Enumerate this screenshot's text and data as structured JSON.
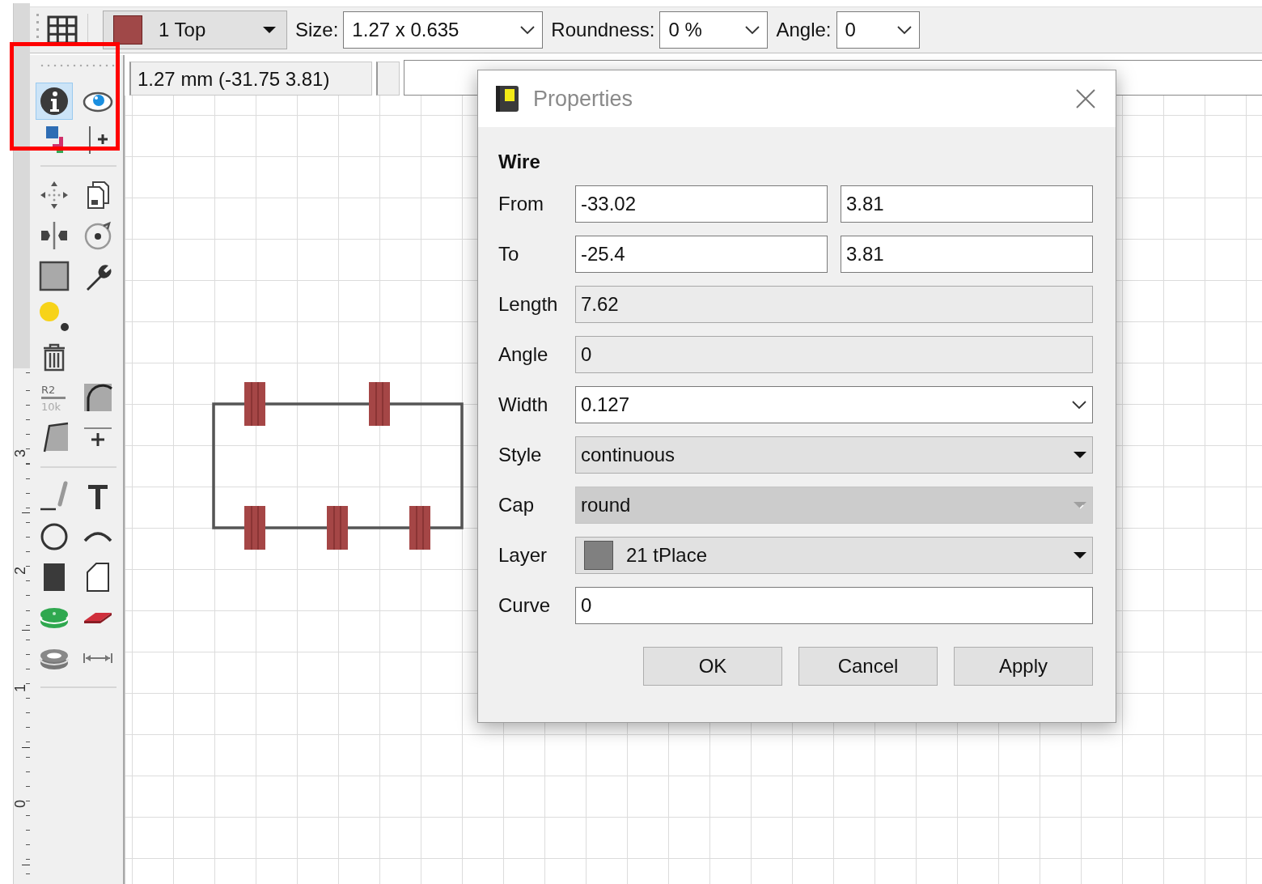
{
  "toolbar": {
    "layer": {
      "label": "1 Top",
      "color": "#a04848"
    },
    "fields": [
      {
        "label": "Size:",
        "value": "1.27 x 0.635"
      },
      {
        "label": "Roundness:",
        "value": "0 %"
      },
      {
        "label": "Angle:",
        "value": "0"
      }
    ]
  },
  "coordinates": {
    "readout": "1.27 mm (-31.75 3.81)"
  },
  "tool_groups": [
    [
      [
        {
          "selected": true
        },
        {
          "selected": false
        }
      ],
      [
        {
          "selected": false
        },
        {
          "selected": false
        }
      ]
    ],
    [
      [
        {
          "selected": false
        },
        {
          "selected": false
        }
      ],
      [
        {
          "selected": false
        },
        {
          "selected": false
        }
      ],
      [
        {
          "selected": false
        },
        {
          "selected": false
        }
      ],
      [
        {
          "selected": false
        }
      ],
      [
        {
          "selected": false
        }
      ],
      [
        {
          "selected": false,
          "caption": [
            "R2",
            "10k"
          ]
        },
        {
          "selected": false
        }
      ],
      [
        {
          "selected": false
        },
        {
          "selected": false
        }
      ]
    ],
    [
      [
        {
          "selected": false
        },
        {
          "selected": false
        }
      ],
      [
        {
          "selected": false
        },
        {
          "selected": false
        }
      ],
      [
        {
          "selected": false
        },
        {
          "selected": false
        }
      ],
      [
        {
          "selected": false
        },
        {
          "selected": false
        }
      ],
      [
        {
          "selected": false
        },
        {
          "selected": false
        }
      ]
    ]
  ],
  "ruler": {
    "labels": [
      "3",
      "2",
      "1",
      "0"
    ]
  },
  "dialog": {
    "title": "Properties",
    "heading": "Wire",
    "rows": [
      {
        "label": "From",
        "kind": "pair",
        "values": [
          "-33.02",
          "3.81"
        ]
      },
      {
        "label": "To",
        "kind": "pair",
        "values": [
          "-25.4",
          "3.81"
        ]
      },
      {
        "label": "Length",
        "kind": "text",
        "value": "7.62",
        "readonly": true
      },
      {
        "label": "Angle",
        "kind": "text",
        "value": "0",
        "readonly": true
      },
      {
        "label": "Width",
        "kind": "combo",
        "value": "0.127"
      },
      {
        "label": "Style",
        "kind": "dropdown",
        "value": "continuous",
        "disabled": false
      },
      {
        "label": "Cap",
        "kind": "dropdown",
        "value": "round",
        "disabled": true
      },
      {
        "label": "Layer",
        "kind": "dropdown",
        "value": "21 tPlace",
        "color": "#808080",
        "disabled": false
      },
      {
        "label": "Curve",
        "kind": "text",
        "value": "0",
        "readonly": false
      }
    ],
    "buttons": [
      "OK",
      "Cancel",
      "Apply"
    ]
  }
}
